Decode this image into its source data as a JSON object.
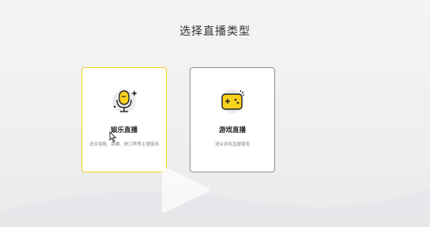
{
  "page": {
    "title": "选择直播类型"
  },
  "cards": [
    {
      "title": "娱乐直播",
      "desc": "适合唱歌、跳舞、脱口秀等主播使用",
      "icon": "microphone-icon",
      "selected": true
    },
    {
      "title": "游戏直播",
      "desc": "适合游戏直播使用",
      "icon": "gamepad-icon",
      "selected": false
    }
  ],
  "colors": {
    "accent": "#f5d21a",
    "selected_border": "#f5d21a",
    "card_border": "#8a8f99",
    "icon_yellow": "#f8d21f"
  }
}
